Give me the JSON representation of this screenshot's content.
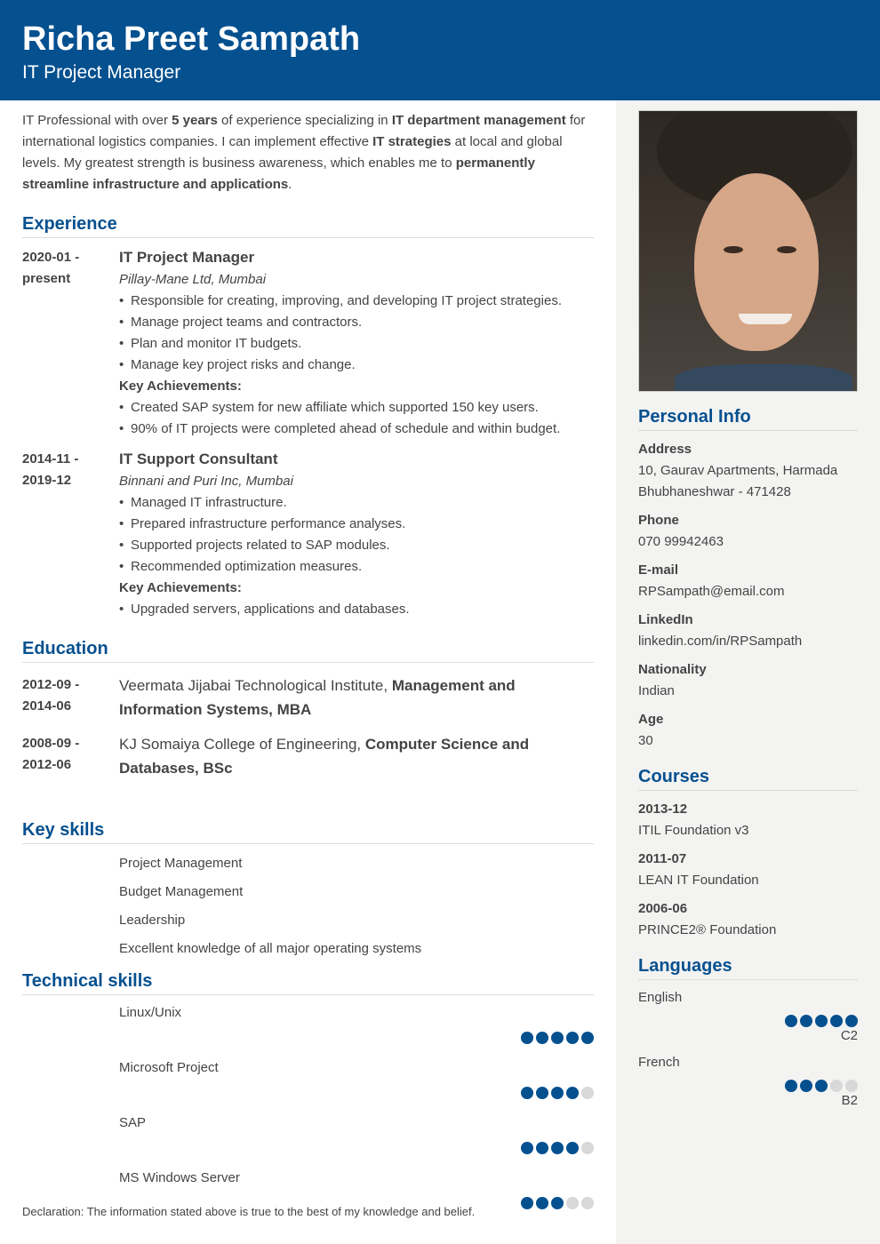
{
  "header": {
    "name": "Richa Preet Sampath",
    "title": "IT Project Manager"
  },
  "colors": {
    "accent": "#05508f",
    "dot_off": "#d8d8d8",
    "sidebar_bg": "#f3f3f2"
  },
  "summary": {
    "parts": [
      {
        "t": "IT Professional with over ",
        "b": false
      },
      {
        "t": "5 years",
        "b": true
      },
      {
        "t": " of experience specializing in ",
        "b": false
      },
      {
        "t": "IT department management",
        "b": true
      },
      {
        "t": " for international logistics companies. I can implement effective ",
        "b": false
      },
      {
        "t": "IT strategies",
        "b": true
      },
      {
        "t": " at local and global levels. My greatest strength is business awareness, which enables me to ",
        "b": false
      },
      {
        "t": "permanently streamline infrastructure and applications",
        "b": true
      },
      {
        "t": ".",
        "b": false
      }
    ]
  },
  "experience": {
    "heading": "Experience",
    "entries": [
      {
        "date_start": "2020-01 -",
        "date_end": "present",
        "title": "IT Project Manager",
        "company": "Pillay-Mane Ltd, Mumbai",
        "bullets": [
          "Responsible for creating, improving, and developing IT project strategies.",
          "Manage project teams and contractors.",
          "Plan and monitor IT budgets.",
          "Manage key project risks and change."
        ],
        "achievements_label": "Key Achievements:",
        "achievements": [
          "Created SAP system for new affiliate which supported 150 key users.",
          "90% of IT projects were completed ahead of schedule and within budget."
        ]
      },
      {
        "date_start": "2014-11 -",
        "date_end": "2019-12",
        "title": "IT Support Consultant",
        "company": "Binnani and Puri Inc, Mumbai",
        "bullets": [
          "Managed IT infrastructure.",
          "Prepared infrastructure performance analyses.",
          "Supported projects related to SAP modules.",
          "Recommended optimization measures."
        ],
        "achievements_label": "Key Achievements:",
        "achievements": [
          "Upgraded servers, applications and databases."
        ]
      }
    ]
  },
  "education": {
    "heading": "Education",
    "entries": [
      {
        "date_start": "2012-09 -",
        "date_end": "2014-06",
        "school": "Veermata Jijabai Technological Institute, ",
        "degree": "Management and Information Systems, MBA"
      },
      {
        "date_start": "2008-09 -",
        "date_end": "2012-06",
        "school": "KJ Somaiya College of Engineering, ",
        "degree": "Computer Science and Databases, BSc"
      }
    ]
  },
  "key_skills": {
    "heading": "Key skills",
    "items": [
      "Project Management",
      "Budget Management",
      "Leadership",
      "Excellent knowledge of all major operating systems"
    ]
  },
  "technical_skills": {
    "heading": "Technical skills",
    "items": [
      {
        "name": "Linux/Unix",
        "level": 5,
        "max": 5
      },
      {
        "name": "Microsoft Project",
        "level": 4,
        "max": 5
      },
      {
        "name": "SAP",
        "level": 4,
        "max": 5
      },
      {
        "name": "MS Windows Server",
        "level": 3,
        "max": 5
      }
    ]
  },
  "declaration": "Declaration: The information stated above is true to the best of my knowledge and belief.",
  "sidebar": {
    "photo_alt": "profile-photo",
    "personal_info": {
      "heading": "Personal Info",
      "fields": [
        {
          "label": "Address",
          "value": [
            "10, Gaurav Apartments, Harmada",
            "Bhubhaneshwar - 471428"
          ]
        },
        {
          "label": "Phone",
          "value": [
            "070 99942463"
          ]
        },
        {
          "label": "E-mail",
          "value": [
            "RPSampath@email.com"
          ]
        },
        {
          "label": "LinkedIn",
          "value": [
            "linkedin.com/in/RPSampath"
          ]
        },
        {
          "label": "Nationality",
          "value": [
            "Indian"
          ]
        },
        {
          "label": "Age",
          "value": [
            "30"
          ]
        }
      ]
    },
    "courses": {
      "heading": "Courses",
      "items": [
        {
          "date": "2013-12",
          "name": "ITIL Foundation v3"
        },
        {
          "date": "2011-07",
          "name": "LEAN IT Foundation"
        },
        {
          "date": "2006-06",
          "name": "PRINCE2® Foundation"
        }
      ]
    },
    "languages": {
      "heading": "Languages",
      "items": [
        {
          "name": "English",
          "level": 5,
          "max": 5,
          "cefr": "C2"
        },
        {
          "name": "French",
          "level": 3,
          "max": 5,
          "cefr": "B2"
        }
      ]
    }
  }
}
